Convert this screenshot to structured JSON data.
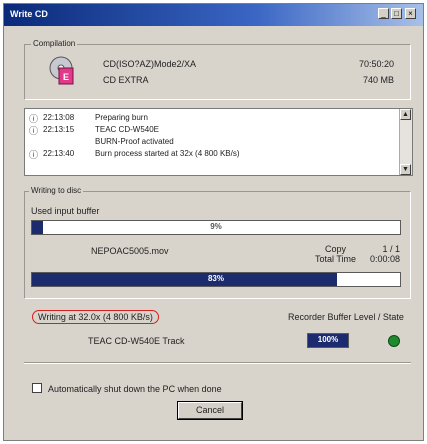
{
  "window": {
    "title": "Write CD"
  },
  "compilation": {
    "group_label": "Compilation",
    "line1": "CD(ISO?AZ)Mode2/XA",
    "line1_value": "70:50:20",
    "line2": "CD EXTRA",
    "line2_value": "740 MB"
  },
  "log": {
    "rows": [
      {
        "time": "22:13:08",
        "msg": "Preparing burn"
      },
      {
        "time": "22:13:15",
        "msg": "TEAC CD-W540E"
      },
      {
        "time": "",
        "msg": "BURN-Proof activated"
      },
      {
        "time": "22:13:40",
        "msg": "Burn process started at 32x (4 800 KB/s)"
      }
    ]
  },
  "writing": {
    "group_label": "Writing to disc",
    "buffer_label": "Used input buffer",
    "buffer_pct": "9%",
    "buffer_fraction": 0.03,
    "file_name": "NEPOAC5005.mov",
    "copy_label": "Copy",
    "copy_value": "1 / 1",
    "total_time_label": "Total Time",
    "total_time_value": "0:00:08",
    "progress_pct": "83%",
    "progress_fraction": 0.83,
    "speed_label": "Writing at 32.0x (4 800 KB/s)",
    "recorder_label": "Recorder Buffer Level / State",
    "device_label": "TEAC CD-W540E  Track",
    "recorder_pct": "100%",
    "state_color": "#1e8a2e"
  },
  "footer": {
    "shutdown_label": "Automatically shut down the PC when done",
    "cancel_label": "Cancel"
  }
}
